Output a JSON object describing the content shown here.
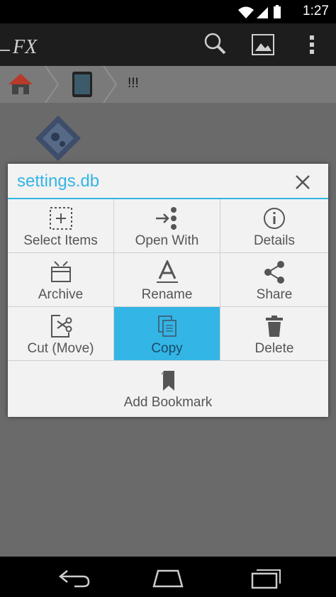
{
  "status_bar": {
    "time": "1:27",
    "icons": [
      "wifi-icon",
      "signal-icon",
      "battery-icon"
    ]
  },
  "action_bar": {
    "logo": "FX",
    "buttons": [
      "search-icon",
      "image-icon",
      "overflow-menu-icon"
    ]
  },
  "breadcrumb": {
    "items": [
      "home-icon",
      "device-icon"
    ],
    "current": "!!!"
  },
  "dialog": {
    "title": "settings.db",
    "actions": [
      {
        "label": "Select Items",
        "icon": "select-items-icon"
      },
      {
        "label": "Open With",
        "icon": "open-with-icon"
      },
      {
        "label": "Details",
        "icon": "info-icon"
      },
      {
        "label": "Archive",
        "icon": "archive-icon"
      },
      {
        "label": "Rename",
        "icon": "rename-icon"
      },
      {
        "label": "Share",
        "icon": "share-icon"
      },
      {
        "label": "Cut (Move)",
        "icon": "cut-icon"
      },
      {
        "label": "Copy",
        "icon": "copy-icon"
      },
      {
        "label": "Delete",
        "icon": "trash-icon"
      },
      {
        "label": "Add Bookmark",
        "icon": "bookmark-icon"
      }
    ],
    "selected": "Copy"
  },
  "nav_bar": {
    "buttons": [
      "back-icon",
      "home-nav-icon",
      "recent-apps-icon"
    ]
  },
  "colors": {
    "accent": "#33b5e5",
    "status_bar": "#000000",
    "action_bar": "#1d1d1d"
  }
}
